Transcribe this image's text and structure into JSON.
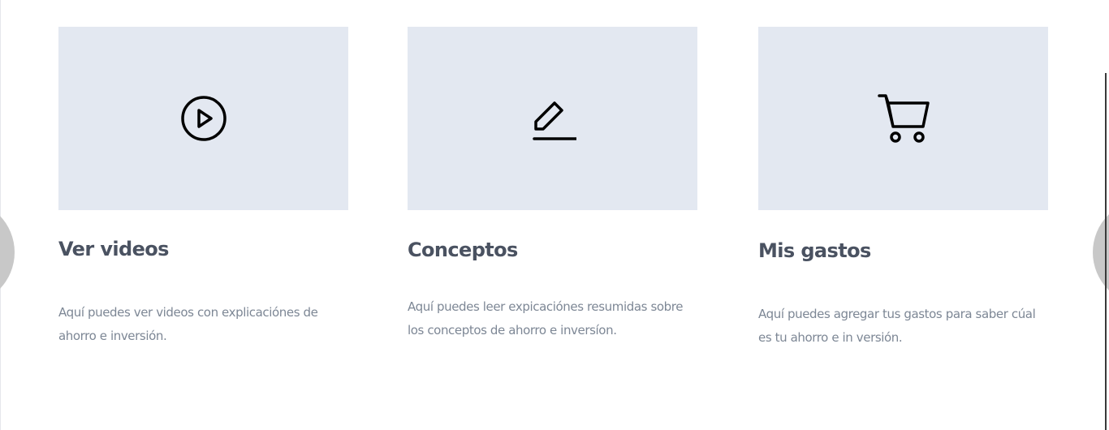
{
  "cards": [
    {
      "icon": "play-circle-icon",
      "title": "Ver videos",
      "description": "Aquí puedes ver videos con explicaciónes de ahorro e inversión."
    },
    {
      "icon": "edit-pen-icon",
      "title": "Conceptos",
      "description": "Aquí puedes leer expicaciónes resumidas sobre los conceptos de ahorro e inversíon."
    },
    {
      "icon": "shopping-cart-icon",
      "title": "Mis gastos",
      "description": "Aquí puedes agregar tus gastos para saber cúal es tu ahorro e in versión."
    }
  ],
  "colors": {
    "card_image_bg": "#e3e8f1",
    "title": "#4a5261",
    "description": "#7d8795",
    "carousel_button": "#c8c8c8"
  }
}
